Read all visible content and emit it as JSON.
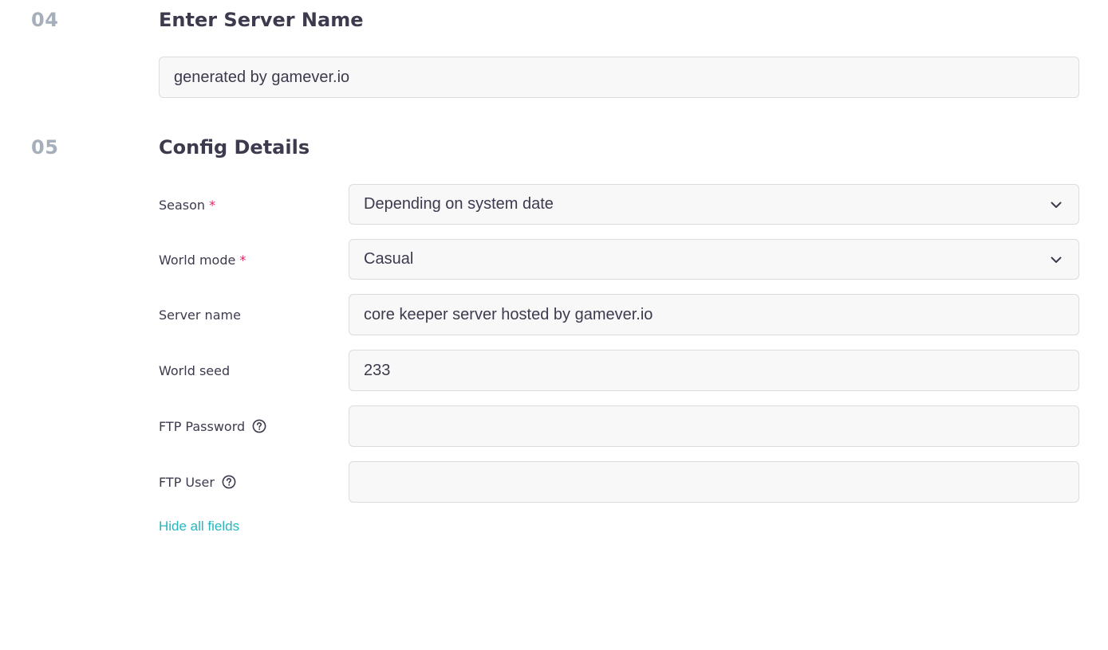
{
  "steps": [
    {
      "number": "04",
      "title": "Enter Server Name"
    },
    {
      "number": "05",
      "title": "Config Details"
    }
  ],
  "server_name_input": {
    "value": "generated by gamever.io"
  },
  "config": {
    "season": {
      "label": "Season",
      "required_mark": "*",
      "value": "Depending on system date"
    },
    "world_mode": {
      "label": "World mode",
      "required_mark": "*",
      "value": "Casual"
    },
    "server_name": {
      "label": "Server name",
      "value": "core keeper server hosted by gamever.io"
    },
    "world_seed": {
      "label": "World seed",
      "value": "233"
    },
    "ftp_password": {
      "label": "FTP Password",
      "value": ""
    },
    "ftp_user": {
      "label": "FTP User",
      "value": ""
    }
  },
  "hide_fields_link": "Hide all fields",
  "colors": {
    "accent_link": "#26b6bd",
    "required": "#e2245e",
    "step_number": "#a5aebb",
    "text": "#3d3a4e",
    "field_bg": "#f8f8f8",
    "field_border": "#dcdce0"
  },
  "icons": {
    "select_arrow": "chevron-down-icon",
    "help": "question-circle-icon"
  }
}
